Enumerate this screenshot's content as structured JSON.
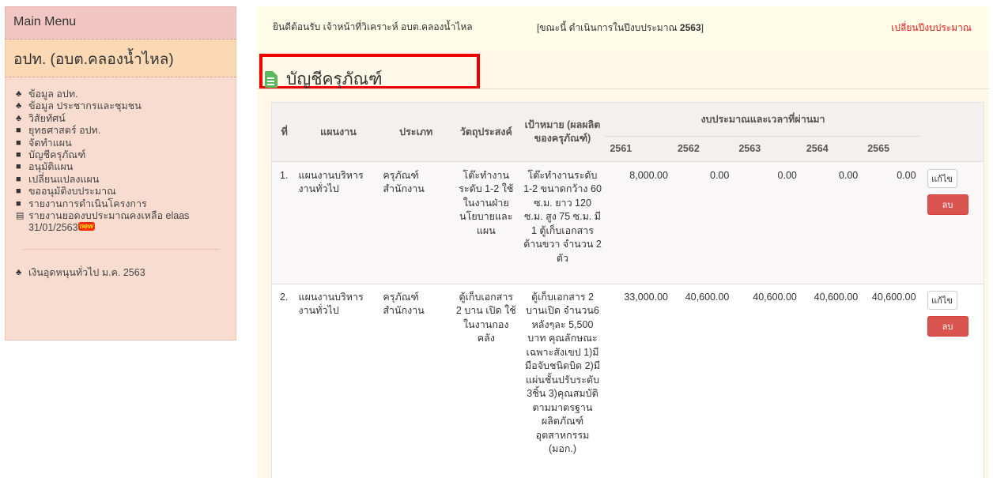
{
  "sidebar": {
    "header": "Main Menu",
    "org_name": "อปท. (อบต.คลองน้ำไหล)",
    "items": [
      {
        "icon": "sitemap-icon",
        "glyph": "♣",
        "label": "ข้อมูล อปท."
      },
      {
        "icon": "sitemap-icon",
        "glyph": "♣",
        "label": "ข้อมูล ประชากรและชุมชน"
      },
      {
        "icon": "sitemap-icon",
        "glyph": "♣",
        "label": "วิสัยทัศน์"
      },
      {
        "icon": "bookmark-icon",
        "glyph": "■",
        "label": "ยุทธศาสตร์ อปท."
      },
      {
        "icon": "bookmark-icon",
        "glyph": "■",
        "label": "จัดทำแผน"
      },
      {
        "icon": "bookmark-icon",
        "glyph": "■",
        "label": "บัญชีครุภัณฑ์"
      },
      {
        "icon": "bookmark-icon",
        "glyph": "■",
        "label": "อนุมัติแผน"
      },
      {
        "icon": "bookmark-icon",
        "glyph": "■",
        "label": "เปลี่ยนแปลงแผน"
      },
      {
        "icon": "bookmark-icon",
        "glyph": "■",
        "label": "ขออนุมัติงบประมาณ"
      },
      {
        "icon": "bookmark-icon",
        "glyph": "■",
        "label": "รายงานการดำเนินโครงการ"
      }
    ],
    "report_item": {
      "icon": "file-icon",
      "glyph": "▤",
      "label": "รายงานยอดงบประมาณคงเหลือ elaas 31/01/2563",
      "badge": "new"
    },
    "bottom_item": {
      "icon": "sitemap-icon",
      "glyph": "♣",
      "label": "เงินอุดหนุนทั่วไป ม.ค. 2563"
    }
  },
  "topbar": {
    "welcome": "ยินดีต้อนรับ เจ้าหน้าที่วิเคราะห์ อบต.คลองน้ำไหล",
    "budget_prefix": "[ขณะนี้ ดำเนินการในปีงบประมาณ ",
    "budget_year": "2563",
    "budget_suffix": "]",
    "change_link": "เปลี่ยนปีงบประมาณ"
  },
  "page": {
    "title": "บัญชีครุภัณฑ์"
  },
  "table": {
    "headers": {
      "no": "ที่",
      "plan": "แผนงาน",
      "type": "ประเภท",
      "objective": "วัตถุประสงค์",
      "target": "เป้าหมาย (ผลผลิตของครุภัณฑ์)",
      "budget_group": "งบประมาณและเวลาที่ผ่านมา",
      "years": [
        "2561",
        "2562",
        "2563",
        "2564",
        "2565"
      ]
    },
    "rows": [
      {
        "no": "1.",
        "plan": "แผนงานบริหารงานทั่วไป",
        "type": "ครุภัณฑ์สำนักงาน",
        "objective": "โต๊ะทำงานระดับ 1-2 ใช้ในงานฝ่ายนโยบายและแผน",
        "target": "โต๊ะทำงานระดับ 1-2 ขนาดกว้าง 60 ซ.ม. ยาว 120 ซ.ม. สูง 75 ซ.ม. มี 1 ตู้เก็บเอกสารด้านขวา จำนวน 2 ตัว",
        "values": [
          "8,000.00",
          "0.00",
          "0.00",
          "0.00",
          "0.00"
        ],
        "edit": "แก้ไข",
        "delete": "ลบ"
      },
      {
        "no": "2.",
        "plan": "แผนงานบริหารงานทั่วไป",
        "type": "ครุภัณฑ์สำนักงาน",
        "objective": "ตู้เก็บเอกสาร 2 บาน เปิด ใช้ในงานกองคลัง",
        "target": "ตู้เก็บเอกสาร 2 บานเปิด จำนวน6 หลังๆละ 5,500 บาท คุณลักษณะเฉพาะสังเขป 1)มีมือจับชนิดบิด 2)มีแผ่นชั้นปรับระดับ 3ชิ้น 3)คุณสมบัติตามมาตรฐานผลิตภัณฑ์อุตสาหกรรม (มอก.)",
        "values": [
          "33,000.00",
          "40,600.00",
          "40,600.00",
          "40,600.00",
          "40,600.00"
        ],
        "edit": "แก้ไข",
        "delete": "ลบ"
      }
    ]
  }
}
